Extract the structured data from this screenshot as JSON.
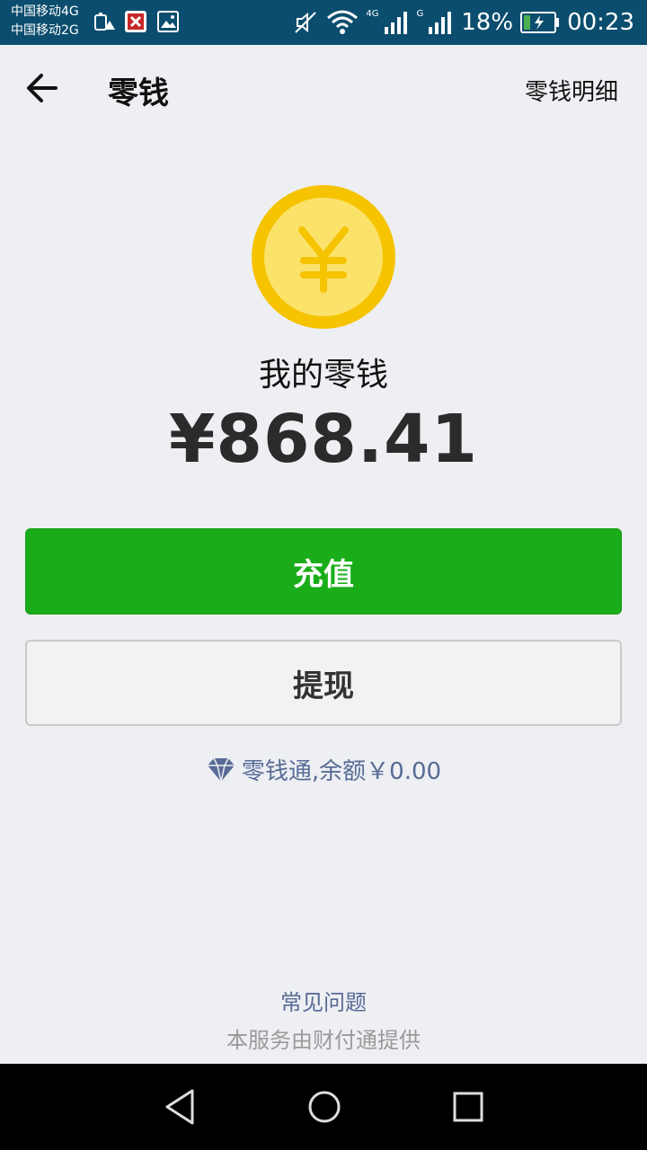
{
  "status_bar": {
    "carrier_1": "中国移动4G",
    "carrier_2": "中国移动2G",
    "net_4g": "4G",
    "net_g": "G",
    "battery": "18%",
    "time": "00:23"
  },
  "header": {
    "title": "零钱",
    "detail_link": "零钱明细"
  },
  "wallet": {
    "label": "我的零钱",
    "balance": "¥868.41",
    "coin_symbol": "¥"
  },
  "actions": {
    "recharge": "充值",
    "withdraw": "提现"
  },
  "lingqiantong": {
    "text": "零钱通,余额￥0.00"
  },
  "footer": {
    "faq": "常见问题",
    "provider": "本服务由财付通提供"
  },
  "colors": {
    "status_bar": "#0b4d6e",
    "primary_green": "#1aad19",
    "link_blue": "#576b95",
    "coin_outer": "#f5c300",
    "coin_inner": "#fbe26a"
  },
  "icons": {
    "back": "back-arrow-icon",
    "coin": "yuan-coin-icon",
    "diamond": "diamond-icon",
    "nav_back": "nav-back-icon",
    "nav_home": "nav-home-icon",
    "nav_recent": "nav-recent-icon"
  }
}
